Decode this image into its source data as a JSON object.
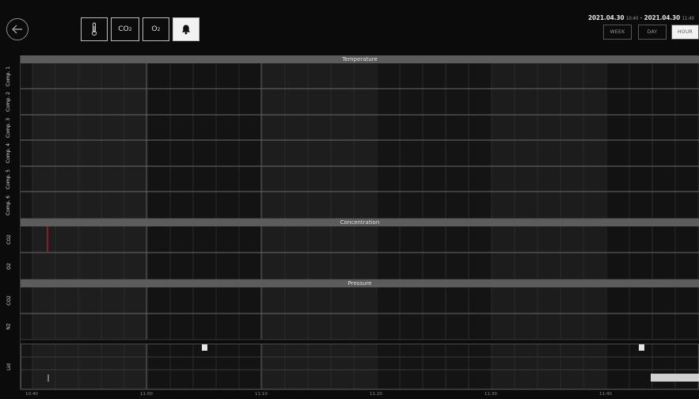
{
  "toolbar": {
    "back_label": "Back",
    "buttons": [
      {
        "name": "thermometer",
        "label": "",
        "icon": "thermometer-icon"
      },
      {
        "name": "co2",
        "label": "CO",
        "sub": "2"
      },
      {
        "name": "o2",
        "label": "O",
        "sub": "2"
      },
      {
        "name": "alarm",
        "label": "",
        "icon": "bell-icon",
        "active": true
      }
    ]
  },
  "date_range": {
    "start_date": "2021.04.30",
    "start_time": "10:40",
    "separator": "-",
    "end_date": "2021.04.30",
    "end_time": "11:40"
  },
  "range_buttons": [
    {
      "label": "WEEK",
      "active": false
    },
    {
      "label": "DAY",
      "active": false
    },
    {
      "label": "HOUR",
      "active": true
    }
  ],
  "sections": {
    "temperature": {
      "title": "Temperature",
      "rows": [
        "Comp. 1",
        "Comp. 2",
        "Comp. 3",
        "Comp. 4",
        "Comp. 5",
        "Comp. 6"
      ]
    },
    "concentration": {
      "title": "Concentration",
      "rows": [
        "CO2",
        "O2"
      ]
    },
    "pressure": {
      "title": "Pressure",
      "rows": [
        "CO2",
        "N2"
      ]
    },
    "events": {
      "rows": [
        "Lid"
      ]
    }
  },
  "time_axis": {
    "ticks": [
      "10:40",
      "11:00",
      "11:10",
      "11:20",
      "11:30",
      "11:40"
    ]
  },
  "colors": {
    "background": "#0b0b0b",
    "section_header": "#5c5c5c",
    "alarm_marker": "#c0202a",
    "event_marker": "#e6e6e6"
  }
}
